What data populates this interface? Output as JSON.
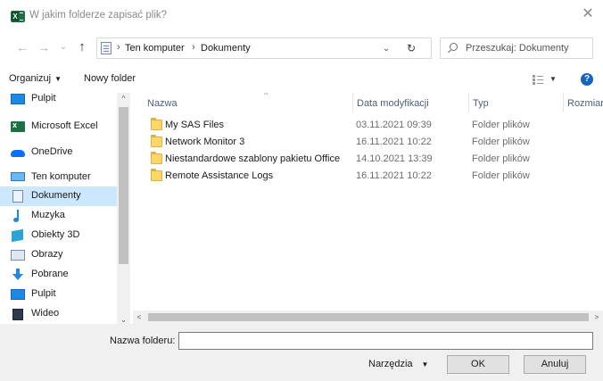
{
  "window": {
    "title": "W jakim folderze zapisać plik?",
    "close_glyph": "✕"
  },
  "nav": {
    "back_glyph": "←",
    "forward_glyph": "→",
    "recent_glyph": "⌄",
    "up_glyph": "↑",
    "address": {
      "crumbs": [
        "Ten komputer",
        "Dokumenty"
      ],
      "separator": "›",
      "dropdown_glyph": "⌄",
      "refresh_glyph": "↻"
    },
    "search": {
      "placeholder": "Przeszukaj: Dokumenty"
    }
  },
  "toolbar": {
    "organize_label": "Organizuj",
    "new_folder_label": "Nowy folder",
    "caret_glyph": "▼",
    "help_glyph": "?"
  },
  "sidebar": {
    "items": [
      {
        "label": "Pulpit",
        "icon": "desktop-icon"
      },
      {
        "label": "Microsoft Excel",
        "icon": "excel-icon"
      },
      {
        "label": "OneDrive",
        "icon": "cloud-icon"
      },
      {
        "label": "Ten komputer",
        "icon": "computer-icon"
      },
      {
        "label": "Dokumenty",
        "icon": "documents-icon",
        "selected": true
      },
      {
        "label": "Muzyka",
        "icon": "music-icon"
      },
      {
        "label": "Obiekty 3D",
        "icon": "objects-3d-icon"
      },
      {
        "label": "Obrazy",
        "icon": "pictures-icon"
      },
      {
        "label": "Pobrane",
        "icon": "downloads-icon"
      },
      {
        "label": "Pulpit",
        "icon": "desktop-icon"
      },
      {
        "label": "Wideo",
        "icon": "video-icon"
      }
    ],
    "scroll_up_glyph": "^",
    "scroll_down_glyph": "⌄"
  },
  "filelist": {
    "columns": {
      "name": "Nazwa",
      "date": "Data modyfikacji",
      "type": "Typ",
      "size": "Rozmiar"
    },
    "sort_glyph": "^",
    "rows": [
      {
        "name": "My SAS Files",
        "date": "03.11.2021 09:39",
        "type": "Folder plików"
      },
      {
        "name": "Network Monitor 3",
        "date": "16.11.2021 10:22",
        "type": "Folder plików"
      },
      {
        "name": "Niestandardowe szablony pakietu Office",
        "date": "14.10.2021 13:39",
        "type": "Folder plików"
      },
      {
        "name": "Remote Assistance Logs",
        "date": "16.11.2021 10:22",
        "type": "Folder plików"
      }
    ],
    "hscroll_left_glyph": "<",
    "hscroll_right_glyph": ">"
  },
  "bottom": {
    "folder_name_label": "Nazwa folderu:",
    "folder_name_value": "",
    "tools_label": "Narzędzia",
    "ok_label": "OK",
    "cancel_label": "Anuluj"
  },
  "colors": {
    "selection": "#cce8ff",
    "folder": "#ffd769",
    "help": "#1565c0",
    "excel": "#1d7044"
  }
}
